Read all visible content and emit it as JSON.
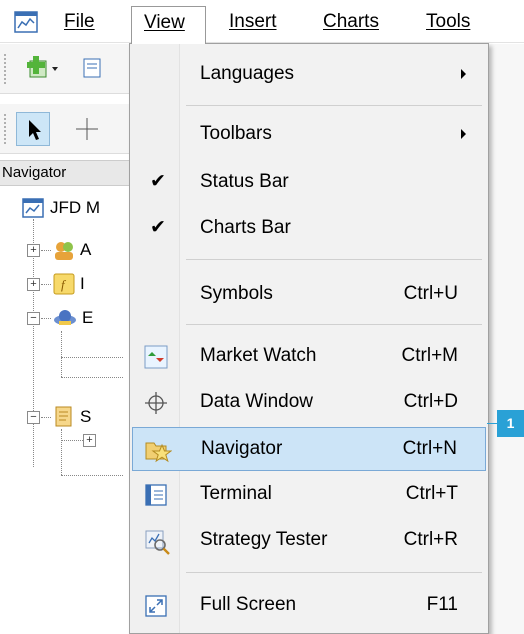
{
  "menubar": {
    "items": [
      {
        "label": "File"
      },
      {
        "label": "View"
      },
      {
        "label": "Insert"
      },
      {
        "label": "Charts"
      },
      {
        "label": "Tools"
      }
    ]
  },
  "navigator": {
    "title": "Navigator",
    "tree": {
      "root_label": "JFD M",
      "node_accounts": "A",
      "node_indicators": "I",
      "node_experts": "E",
      "node_scripts": "S"
    }
  },
  "view_menu": {
    "items": [
      {
        "label": "Languages",
        "shortcut": "",
        "submenu": true
      },
      {
        "label": "Toolbars",
        "shortcut": "",
        "submenu": true
      },
      {
        "label": "Status Bar",
        "shortcut": "",
        "checked": true
      },
      {
        "label": "Charts Bar",
        "shortcut": "",
        "checked": true
      },
      {
        "label": "Symbols",
        "shortcut": "Ctrl+U"
      },
      {
        "label": "Market Watch",
        "shortcut": "Ctrl+M",
        "icon": "market-watch-icon"
      },
      {
        "label": "Data Window",
        "shortcut": "Ctrl+D",
        "icon": "crosshair-icon"
      },
      {
        "label": "Navigator",
        "shortcut": "Ctrl+N",
        "icon": "navigator-star-folder-icon",
        "highlighted": true
      },
      {
        "label": "Terminal",
        "shortcut": "Ctrl+T",
        "icon": "terminal-icon"
      },
      {
        "label": "Strategy Tester",
        "shortcut": "Ctrl+R",
        "icon": "strategy-tester-icon"
      },
      {
        "label": "Full Screen",
        "shortcut": "F11",
        "icon": "full-screen-icon"
      }
    ],
    "check_glyph": "✔"
  },
  "annotation": {
    "number": "1"
  },
  "colors": {
    "highlight": "#cce4f7",
    "badge": "#2aa1d6"
  }
}
